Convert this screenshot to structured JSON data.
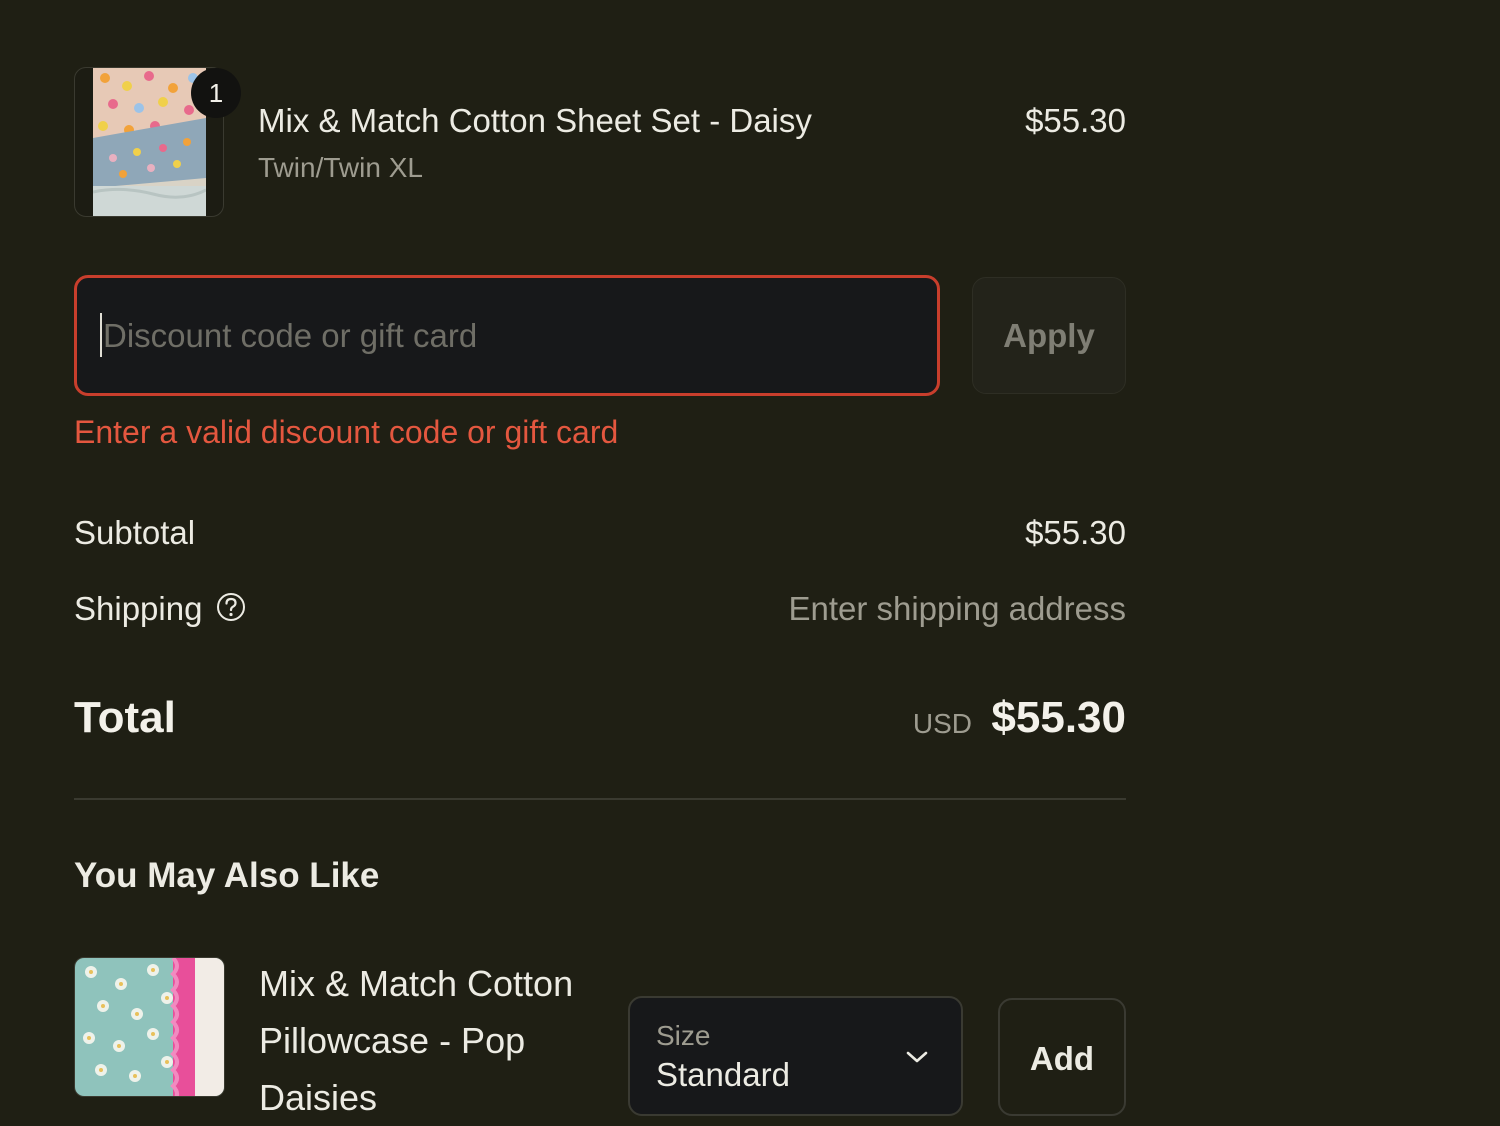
{
  "cart_item": {
    "quantity": "1",
    "title": "Mix & Match Cotton Sheet Set - Daisy",
    "variant": "Twin/Twin XL",
    "price": "$55.30"
  },
  "discount": {
    "placeholder": "Discount code or gift card",
    "value": "",
    "apply_label": "Apply",
    "error": "Enter a valid discount code or gift card"
  },
  "summary": {
    "subtotal_label": "Subtotal",
    "subtotal_value": "$55.30",
    "shipping_label": "Shipping",
    "shipping_value": "Enter shipping address",
    "total_label": "Total",
    "total_currency": "USD",
    "total_value": "$55.30"
  },
  "recommendations": {
    "heading": "You May Also Like",
    "items": [
      {
        "title": "Mix & Match Cotton Pillowcase - Pop Daisies",
        "size_label": "Size",
        "size_value": "Standard",
        "add_label": "Add"
      }
    ]
  },
  "colors": {
    "background": "#1f1f14",
    "error": "#e4573f",
    "error_border": "#c83e2c",
    "text_primary": "#ecebe3",
    "text_secondary": "#9e9c90"
  },
  "icons": {
    "help": "question-circle-icon",
    "chevron": "chevron-down-icon"
  }
}
